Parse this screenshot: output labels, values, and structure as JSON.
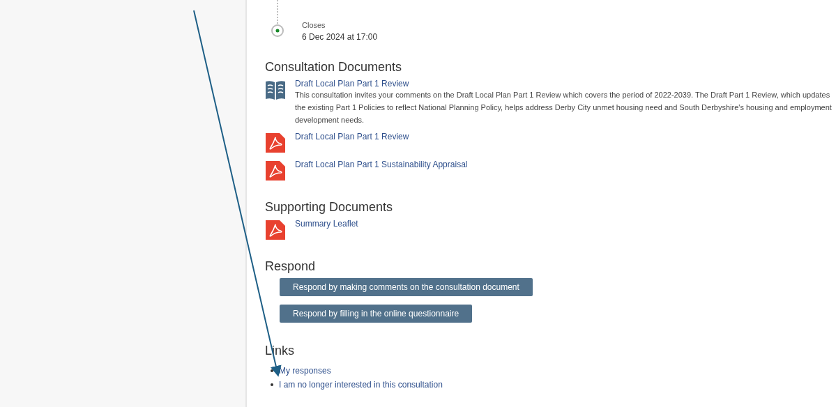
{
  "timeline": {
    "label": "Closes",
    "date": "6 Dec 2024 at 17:00"
  },
  "consultation_documents": {
    "heading": "Consultation Documents",
    "items": [
      {
        "kind": "document",
        "title": "Draft Local Plan Part 1 Review",
        "description": "This consultation invites your comments on the Draft Local Plan Part 1 Review which covers the period of 2022-2039. The Draft Part 1 Review, which updates the existing Part 1 Policies to reflect National Planning Policy, helps address Derby City unmet housing need and South Derbyshire's housing and employment development needs."
      },
      {
        "kind": "pdf",
        "title": "Draft Local Plan Part 1 Review"
      },
      {
        "kind": "pdf",
        "title": "Draft Local Plan Part 1 Sustainability Appraisal"
      }
    ]
  },
  "supporting_documents": {
    "heading": "Supporting Documents",
    "items": [
      {
        "kind": "pdf",
        "title": "Summary Leaflet"
      }
    ]
  },
  "respond": {
    "heading": "Respond",
    "buttons": [
      "Respond by making comments on the consultation document",
      "Respond by filling in the online questionnaire"
    ]
  },
  "links": {
    "heading": "Links",
    "items": [
      "My responses",
      "I am no longer interested in this consultation"
    ]
  }
}
